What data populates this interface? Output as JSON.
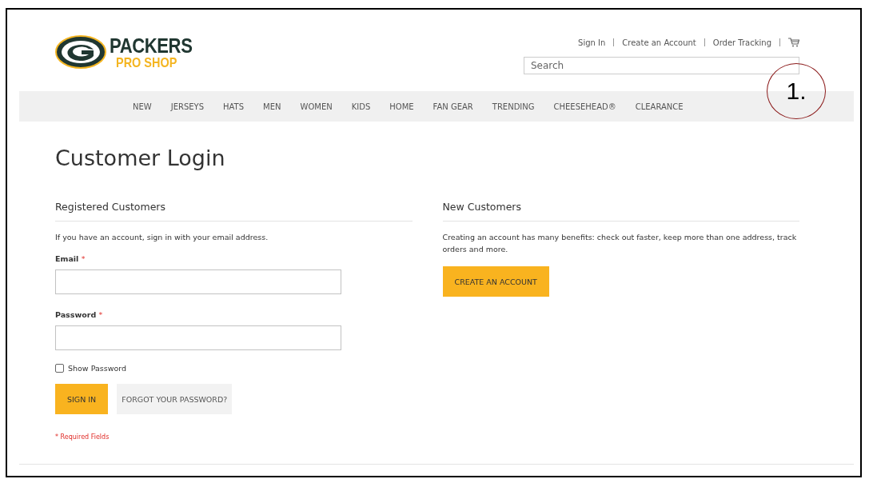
{
  "logo": {
    "title": "PACKERS",
    "subtitle": "PRO SHOP"
  },
  "top_links": [
    "Sign In",
    "Create an Account",
    "Order Tracking"
  ],
  "search": {
    "placeholder": "Search"
  },
  "nav": [
    "NEW",
    "JERSEYS",
    "HATS",
    "MEN",
    "WOMEN",
    "KIDS",
    "HOME",
    "FAN GEAR",
    "TRENDING",
    "CHEESEHEAD®",
    "CLEARANCE"
  ],
  "page_title": "Customer Login",
  "registered": {
    "heading": "Registered Customers",
    "intro": "If you have an account, sign in with your email address.",
    "fields": [
      {
        "label": "Email",
        "required_mark": "*"
      },
      {
        "label": "Password",
        "required_mark": "*"
      }
    ],
    "show_password": {
      "label": "Show Password",
      "checked": false
    },
    "sign_in_button": "SIGN IN",
    "forgot_button": "FORGOT YOUR PASSWORD?",
    "required_note": "* Required Fields"
  },
  "new_customers": {
    "heading": "New Customers",
    "text": "Creating an account has many benefits: check out faster, keep more than one address, track orders and more.",
    "button": "CREATE AN ACCOUNT"
  },
  "annotation": "1."
}
